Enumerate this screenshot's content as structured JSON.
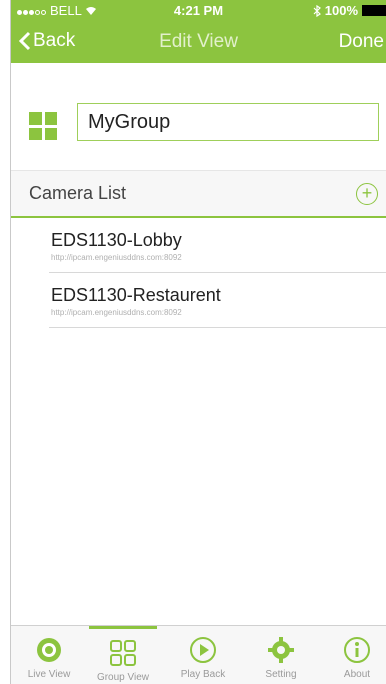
{
  "status": {
    "carrier": "BELL",
    "time": "4:21 PM",
    "battery": "100%"
  },
  "nav": {
    "back": "Back",
    "title": "Edit View",
    "done": "Done"
  },
  "group": {
    "name": "MyGroup"
  },
  "camera_list": {
    "label": "Camera List",
    "items": [
      {
        "name": "EDS1130-Lobby",
        "url": "http://ipcam.engeniusddns.com:8092"
      },
      {
        "name": "EDS1130-Restaurent",
        "url": "http://ipcam.engeniusddns.com:8092"
      }
    ]
  },
  "tabs": [
    {
      "label": "Live View",
      "icon": "live-view-icon"
    },
    {
      "label": "Group View",
      "icon": "group-view-icon",
      "active": true
    },
    {
      "label": "Play Back",
      "icon": "play-back-icon"
    },
    {
      "label": "Setting",
      "icon": "gear-icon"
    },
    {
      "label": "About",
      "icon": "info-icon"
    }
  ],
  "colors": {
    "accent": "#8cc43f"
  }
}
